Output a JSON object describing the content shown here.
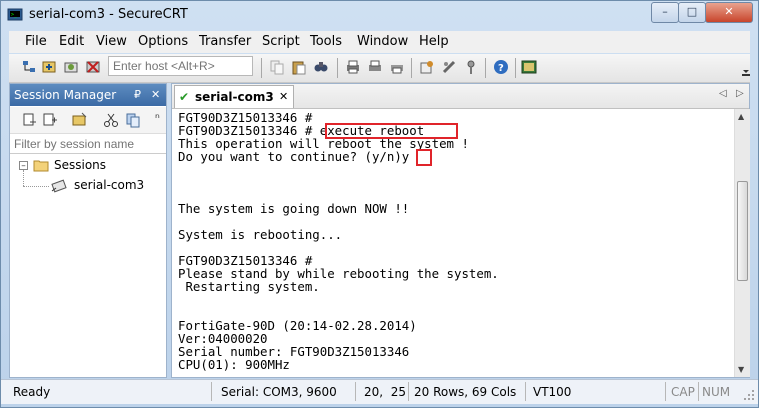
{
  "window": {
    "title": "serial-com3 - SecureCRT",
    "buttons": {
      "minimize": "–",
      "maximize": "□",
      "close": "✕"
    }
  },
  "menu": [
    "File",
    "Edit",
    "View",
    "Options",
    "Transfer",
    "Script",
    "Tools",
    "Window",
    "Help"
  ],
  "toolbar": {
    "quick_connect_placeholder": "Enter host <Alt+R>",
    "icons": [
      "connect-icon",
      "quick-connect-icon",
      "connect-in-tab-icon",
      "disconnect-icon",
      "copy-icon",
      "paste-icon",
      "find-icon",
      "print-icon",
      "print-selection-icon",
      "print-screen-icon",
      "session-options-icon",
      "global-options-icon",
      "keymap-icon",
      "help-icon",
      "sftp-icon"
    ]
  },
  "session_manager": {
    "title": "Session Manager",
    "pin": "₽",
    "close": "✕",
    "filter_placeholder": "Filter by session name",
    "tree": {
      "root_label": "Sessions",
      "child_label": "serial-com3"
    }
  },
  "tabs": [
    {
      "label": "serial-com3",
      "close": "✕"
    }
  ],
  "terminal": {
    "lines": [
      "FGT90D3Z15013346 #",
      "FGT90D3Z15013346 # execute reboot",
      "This operation will reboot the system !",
      "Do you want to continue? (y/n)y",
      "",
      "",
      "",
      "The system is going down NOW !!",
      "",
      "System is rebooting...",
      "",
      "FGT90D3Z15013346 #",
      "Please stand by while rebooting the system.",
      " Restarting system.",
      "",
      "",
      "FortiGate-90D (20:14-02.28.2014)",
      "Ver:04000020",
      "Serial number: FGT90D3Z15013346",
      "CPU(01): 900MHz"
    ]
  },
  "status": {
    "ready": "Ready",
    "connection": "Serial: COM3, 9600",
    "cursor": "20,  25",
    "size": "20 Rows, 69 Cols",
    "emulation": "VT100",
    "cap": "CAP",
    "num": "NUM"
  },
  "colors": {
    "highlight": "#e0242a",
    "pane_header": "#3b6aa5"
  }
}
